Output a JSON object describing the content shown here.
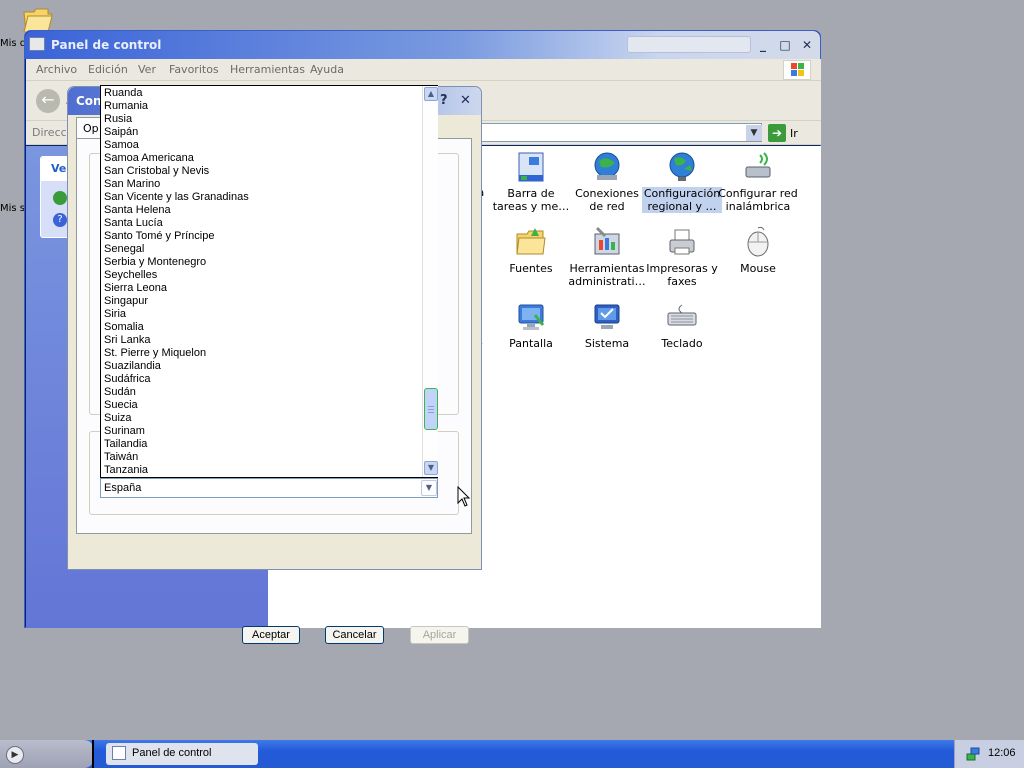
{
  "desktop": {
    "icon1_label": "Mis d",
    "icon2_label": "Mis s"
  },
  "window": {
    "title": "Panel de control",
    "menu": [
      "Archivo",
      "Edición",
      "Ver",
      "Favoritos",
      "Herramientas",
      "Ayuda"
    ],
    "address_label": "Direcci",
    "back_label": "A",
    "go_label": "Ir",
    "task_box_title": "Ve"
  },
  "control_panel_items": [
    {
      "label": "Barra de tareas y me…",
      "icon": "taskbar-icon"
    },
    {
      "label": "Conexiones de red",
      "icon": "network-connections-icon"
    },
    {
      "label": "Configuración regional y …",
      "icon": "regional-settings-icon",
      "selected": true
    },
    {
      "label": "Configurar red inalámbrica",
      "icon": "wireless-setup-icon"
    },
    {
      "label": "Fuentes",
      "icon": "fonts-folder-icon"
    },
    {
      "label": "Herramientas administrati…",
      "icon": "admin-tools-icon"
    },
    {
      "label": "Impresoras y faxes",
      "icon": "printer-icon"
    },
    {
      "label": "Mouse",
      "icon": "mouse-icon"
    },
    {
      "label": "Pantalla",
      "icon": "display-icon"
    },
    {
      "label": "Sistema",
      "icon": "system-icon"
    },
    {
      "label": "Teclado",
      "icon": "keyboard-icon"
    }
  ],
  "partial_labels": {
    "ra": "ra",
    "dots": "…",
    "e": "e",
    "a": "a"
  },
  "dialog": {
    "title": "Con",
    "tab": "Op",
    "help": "?",
    "close": "✕",
    "buttons": {
      "ok": "Aceptar",
      "cancel": "Cancelar",
      "apply": "Aplicar"
    }
  },
  "location_list": {
    "items": [
      "Ruanda",
      "Rumania",
      "Rusia",
      "Saipán",
      "Samoa",
      "Samoa Americana",
      "San Cristobal y Nevis",
      "San Marino",
      "San Vicente y las Granadinas",
      "Santa Helena",
      "Santa Lucía",
      "Santo Tomé y Príncipe",
      "Senegal",
      "Serbia y Montenegro",
      "Seychelles",
      "Sierra Leona",
      "Singapur",
      "Siria",
      "Somalia",
      "Sri Lanka",
      "St. Pierre y Miquelon",
      "Suazilandia",
      "Sudáfrica",
      "Sudán",
      "Suecia",
      "Suiza",
      "Surinam",
      "Tailandia",
      "Taiwán",
      "Tanzania"
    ],
    "selected_value": "España"
  },
  "taskbar": {
    "task_label": "Panel de control",
    "clock": "12:06"
  },
  "colors": {
    "title_bar": "#3a63d8",
    "selection": "#c1d2ee",
    "scroll_thumb_border": "#3cb54a"
  }
}
